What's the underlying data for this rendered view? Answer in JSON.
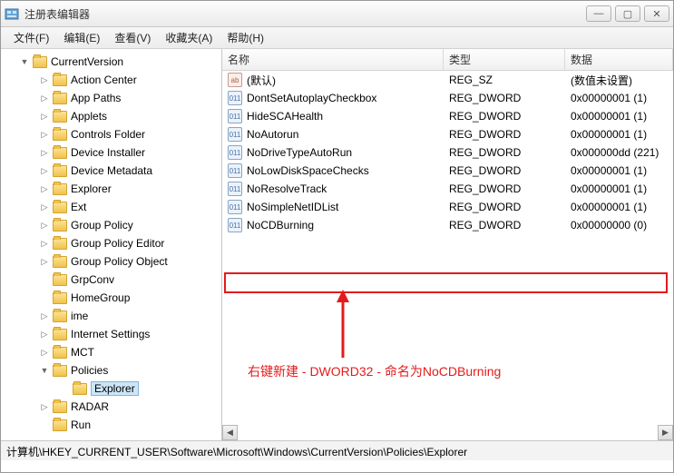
{
  "window": {
    "title": "注册表编辑器"
  },
  "menu": {
    "file": "文件(F)",
    "edit": "编辑(E)",
    "view": "查看(V)",
    "fav": "收藏夹(A)",
    "help": "帮助(H)"
  },
  "tree": {
    "items": [
      {
        "label": "CurrentVersion",
        "indent": 1,
        "exp": "▼"
      },
      {
        "label": "Action Center",
        "indent": 2,
        "exp": "▷"
      },
      {
        "label": "App Paths",
        "indent": 2,
        "exp": "▷"
      },
      {
        "label": "Applets",
        "indent": 2,
        "exp": "▷"
      },
      {
        "label": "Controls Folder",
        "indent": 2,
        "exp": "▷"
      },
      {
        "label": "Device Installer",
        "indent": 2,
        "exp": "▷"
      },
      {
        "label": "Device Metadata",
        "indent": 2,
        "exp": "▷"
      },
      {
        "label": "Explorer",
        "indent": 2,
        "exp": "▷"
      },
      {
        "label": "Ext",
        "indent": 2,
        "exp": "▷"
      },
      {
        "label": "Group Policy",
        "indent": 2,
        "exp": "▷"
      },
      {
        "label": "Group Policy Editor",
        "indent": 2,
        "exp": "▷"
      },
      {
        "label": "Group Policy Object",
        "indent": 2,
        "exp": "▷"
      },
      {
        "label": "GrpConv",
        "indent": 2,
        "exp": ""
      },
      {
        "label": "HomeGroup",
        "indent": 2,
        "exp": ""
      },
      {
        "label": "ime",
        "indent": 2,
        "exp": "▷"
      },
      {
        "label": "Internet Settings",
        "indent": 2,
        "exp": "▷"
      },
      {
        "label": "MCT",
        "indent": 2,
        "exp": "▷"
      },
      {
        "label": "Policies",
        "indent": 2,
        "exp": "▼"
      },
      {
        "label": "Explorer",
        "indent": 3,
        "exp": "",
        "selected": true
      },
      {
        "label": "RADAR",
        "indent": 2,
        "exp": "▷"
      },
      {
        "label": "Run",
        "indent": 2,
        "exp": ""
      }
    ]
  },
  "columns": {
    "name": "名称",
    "type": "类型",
    "data": "数据"
  },
  "rows": [
    {
      "name": "(默认)",
      "type": "REG_SZ",
      "data": "(数值未设置)",
      "iconClass": "str",
      "iconText": "ab"
    },
    {
      "name": "DontSetAutoplayCheckbox",
      "type": "REG_DWORD",
      "data": "0x00000001 (1)",
      "iconClass": "",
      "iconText": "011"
    },
    {
      "name": "HideSCAHealth",
      "type": "REG_DWORD",
      "data": "0x00000001 (1)",
      "iconClass": "",
      "iconText": "011"
    },
    {
      "name": "NoAutorun",
      "type": "REG_DWORD",
      "data": "0x00000001 (1)",
      "iconClass": "",
      "iconText": "011"
    },
    {
      "name": "NoDriveTypeAutoRun",
      "type": "REG_DWORD",
      "data": "0x000000dd (221)",
      "iconClass": "",
      "iconText": "011"
    },
    {
      "name": "NoLowDiskSpaceChecks",
      "type": "REG_DWORD",
      "data": "0x00000001 (1)",
      "iconClass": "",
      "iconText": "011"
    },
    {
      "name": "NoResolveTrack",
      "type": "REG_DWORD",
      "data": "0x00000001 (1)",
      "iconClass": "",
      "iconText": "011"
    },
    {
      "name": "NoSimpleNetIDList",
      "type": "REG_DWORD",
      "data": "0x00000001 (1)",
      "iconClass": "",
      "iconText": "011"
    },
    {
      "name": "NoCDBurning",
      "type": "REG_DWORD",
      "data": "0x00000000 (0)",
      "iconClass": "",
      "iconText": "011"
    }
  ],
  "annotation": "右键新建 - DWORD32 - 命名为NoCDBurning",
  "statusbar": "计算机\\HKEY_CURRENT_USER\\Software\\Microsoft\\Windows\\CurrentVersion\\Policies\\Explorer"
}
